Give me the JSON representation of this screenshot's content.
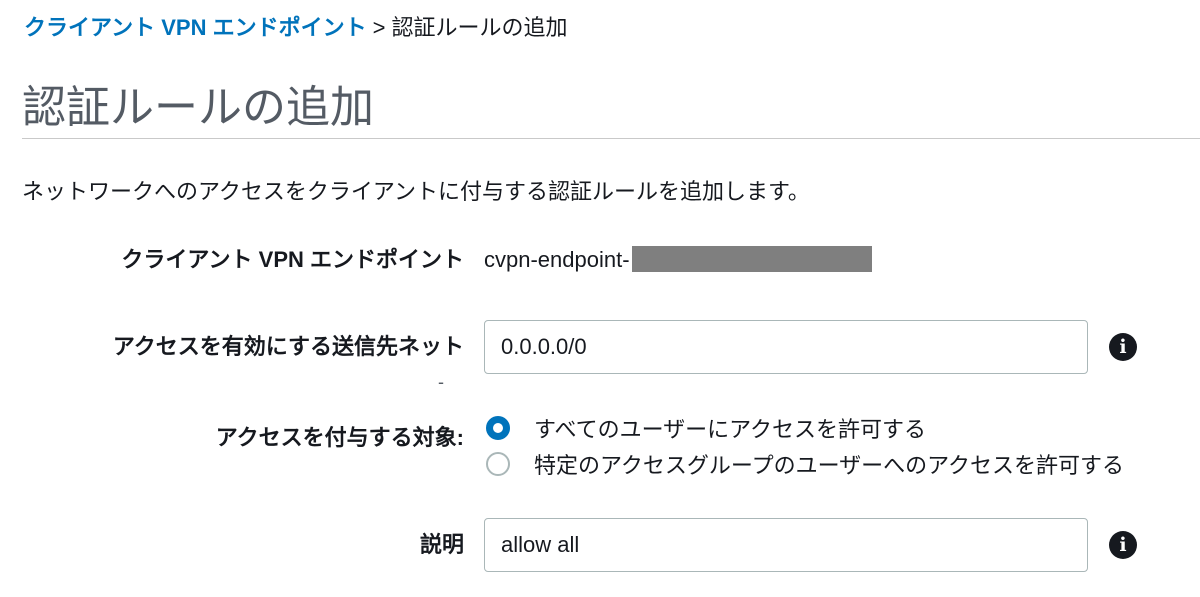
{
  "breadcrumb": {
    "parent": "クライアント VPN エンドポイント",
    "separator": ">",
    "current": "認証ルールの追加"
  },
  "page": {
    "title": "認証ルールの追加",
    "description": "ネットワークへのアクセスをクライアントに付与する認証ルールを追加します。"
  },
  "form": {
    "endpoint": {
      "label": "クライアント VPN エンドポイント",
      "value": "cvpn-endpoint-"
    },
    "destination": {
      "label": "アクセスを有効にする送信先ネット",
      "value": "0.0.0.0/0",
      "trailing_mark": "-"
    },
    "grant_access": {
      "label": "アクセスを付与する対象:",
      "options": [
        {
          "label": "すべてのユーザーにアクセスを許可する",
          "selected": true
        },
        {
          "label": "特定のアクセスグループのユーザーへのアクセスを許可する",
          "selected": false
        }
      ]
    },
    "description": {
      "label": "説明",
      "value": "allow all"
    },
    "info_icon_glyph": "i"
  },
  "colors": {
    "link": "#0073bb",
    "title": "#545b64",
    "text": "#16191f",
    "radio_selected": "#0073bb",
    "redaction": "#7f7f7f"
  }
}
